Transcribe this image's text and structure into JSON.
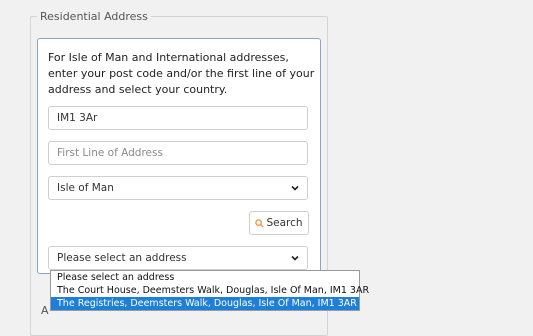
{
  "section": {
    "legend": "Residential Address",
    "intro": "For Isle of Man and International addresses, enter your post code and/or the first line of your address and select your country."
  },
  "form": {
    "postcode_value": "IM1 3Ar",
    "first_line_placeholder": "First Line of Address",
    "country_value": "Isle of Man",
    "search_label": "Search",
    "address_select_value": "Please select an address"
  },
  "dropdown": {
    "options": [
      "Please select an address",
      "The Court House, Deemsters Walk, Douglas, Isle Of Man, IM1 3AR",
      "The Registries, Deemsters Walk, Douglas, Isle Of Man, IM1 3AR"
    ],
    "highlighted_index": 2
  },
  "partial_label": "A",
  "colors": {
    "accent": "#1e7fd8",
    "search_icon": "#e8903a"
  }
}
